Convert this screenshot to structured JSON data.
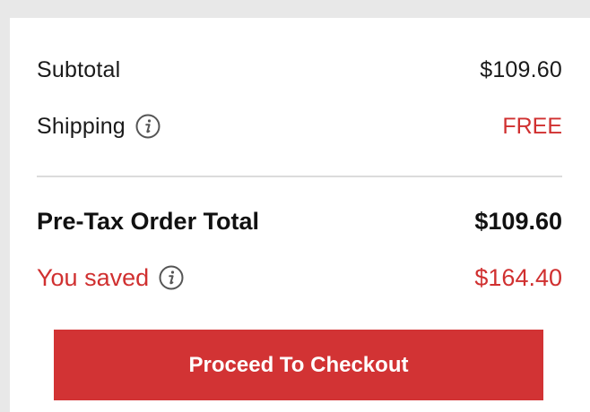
{
  "summary": {
    "subtotal_label": "Subtotal",
    "subtotal_value": "$109.60",
    "shipping_label": "Shipping",
    "shipping_value": "FREE",
    "total_label": "Pre-Tax Order Total",
    "total_value": "$109.60",
    "saved_label": "You saved",
    "saved_value": "$164.40"
  },
  "actions": {
    "checkout_label": "Proceed To Checkout"
  },
  "icons": {
    "shipping_info": "info-icon",
    "saved_info": "info-icon"
  },
  "colors": {
    "accent_red": "#d23334",
    "text_dark": "#111111",
    "background": "#e8e8e8",
    "card": "#ffffff"
  }
}
